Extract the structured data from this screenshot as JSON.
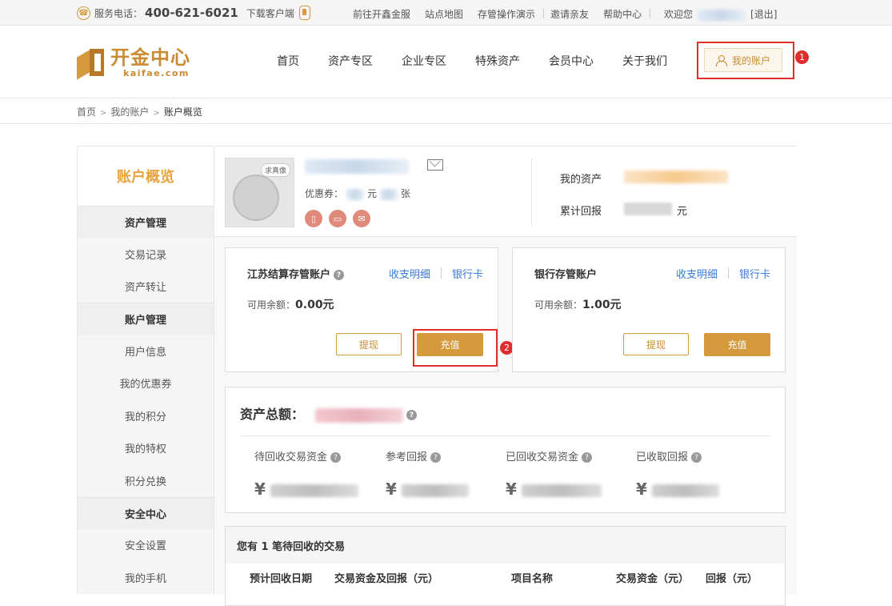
{
  "topbar": {
    "phone_label": "服务电话：",
    "phone_number": "400-621-6021",
    "download": "下载客户端",
    "links": [
      "前往开鑫金服",
      "站点地图",
      "存管操作演示",
      "邀请亲友",
      "帮助中心"
    ],
    "welcome": "欢迎您",
    "logout": "[退出]"
  },
  "header": {
    "logo_cn": "开金中心",
    "logo_en": "kaifae.com",
    "nav": [
      "首页",
      "资产专区",
      "企业专区",
      "特殊资产",
      "会员中心",
      "关于我们"
    ],
    "my_account": "我的账户",
    "marker_1": "1"
  },
  "breadcrumb": [
    "首页",
    "我的账户",
    "账户概览"
  ],
  "sidebar": {
    "title": "账户概览",
    "groups": [
      {
        "label": "资产管理",
        "items": [
          "交易记录",
          "资产转让"
        ]
      },
      {
        "label": "账户管理",
        "items": [
          "用户信息",
          "我的优惠券",
          "我的积分",
          "我的特权",
          "积分兑换"
        ]
      },
      {
        "label": "安全中心",
        "items": [
          "安全设置",
          "我的手机"
        ]
      }
    ]
  },
  "profile": {
    "avatar_tag": "求真像",
    "coupon_label": "优惠券：",
    "coupon_unit_yuan": "元",
    "coupon_unit_zhang": "张",
    "my_assets": "我的资产",
    "total_return": "累计回报",
    "yuan": "元"
  },
  "cards": [
    {
      "title": "江苏结算存管账户",
      "link1": "收支明细",
      "link2": "银行卡",
      "balance_label": "可用余额：",
      "balance": "0.00元",
      "withdraw": "提现",
      "recharge": "充值"
    },
    {
      "title": "银行存管账户",
      "link1": "收支明细",
      "link2": "银行卡",
      "balance_label": "可用余额：",
      "balance": "1.00元",
      "withdraw": "提现",
      "recharge": "充值"
    }
  ],
  "marker_2": "2",
  "total": {
    "title": "资产总额：",
    "stats": [
      {
        "label": "待回收交易资金",
        "value": "¥"
      },
      {
        "label": "参考回报",
        "value": "¥"
      },
      {
        "label": "已回收交易资金",
        "value": "¥"
      },
      {
        "label": "已收取回报",
        "value": "¥"
      }
    ]
  },
  "pending": {
    "title": "您有 1 笔待回收的交易",
    "columns": [
      "预计回收日期",
      "交易资金及回报（元）",
      "项目名称",
      "交易资金（元）",
      "回报（元）"
    ]
  },
  "colors": {
    "gold": "#d49a3c",
    "accent_orange": "#e8a33a",
    "red_marker": "#e02d2d",
    "link_blue": "#3a7bd5"
  }
}
